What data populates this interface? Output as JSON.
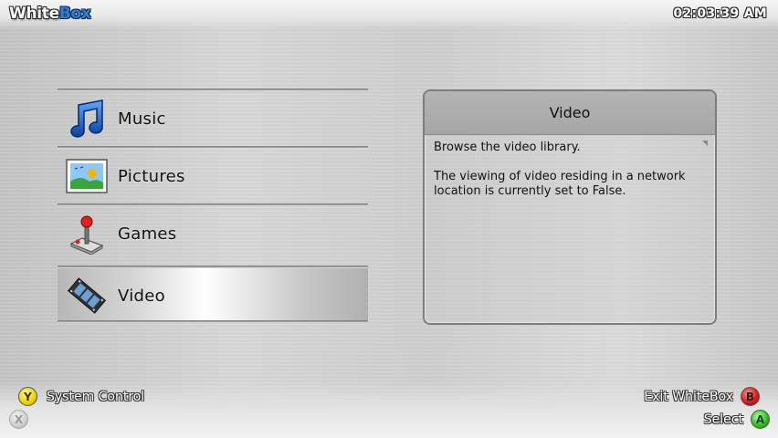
{
  "header": {
    "logo_part1": "White",
    "logo_part2": "Box",
    "clock": "02:03:39 AM"
  },
  "menu": {
    "items": [
      {
        "label": "Music",
        "icon": "music-notes-icon",
        "selected": false
      },
      {
        "label": "Pictures",
        "icon": "picture-landscape-icon",
        "selected": false
      },
      {
        "label": "Games",
        "icon": "joystick-icon",
        "selected": false
      },
      {
        "label": "Video",
        "icon": "film-strip-icon",
        "selected": true
      }
    ]
  },
  "info_panel": {
    "title": "Video",
    "line1": "Browse the video library.",
    "line2": "The viewing of video residing in a network location is currently set to False."
  },
  "footer": {
    "system_control": {
      "label": "System Control",
      "button": "Y"
    },
    "x_button": {
      "button": "X"
    },
    "exit": {
      "label": "Exit WhiteBox",
      "button": "B"
    },
    "select": {
      "label": "Select",
      "button": "A"
    }
  },
  "colors": {
    "accent_blue": "#2f7fd8",
    "button_y": "#f2d600",
    "button_b": "#e01818",
    "button_a": "#33c21f"
  }
}
